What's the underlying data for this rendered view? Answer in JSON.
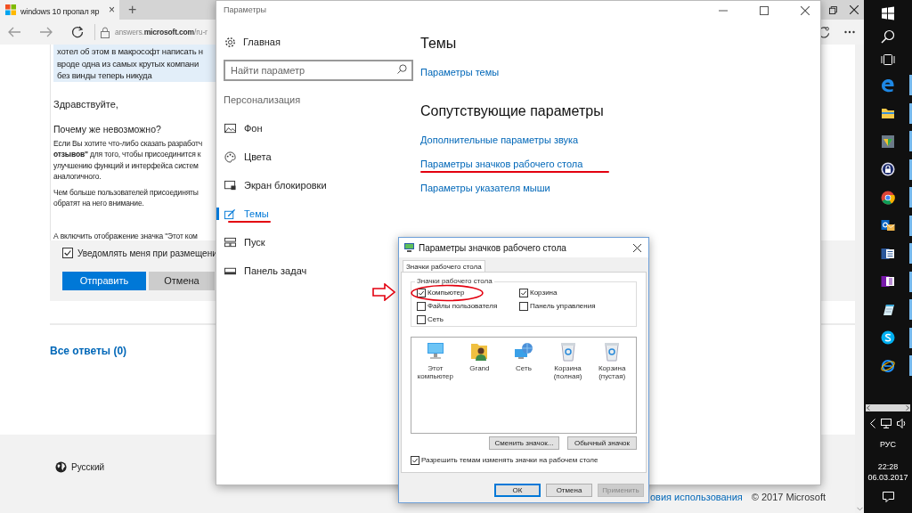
{
  "browser": {
    "tab": {
      "title": "windows 10 пропал яр",
      "close": "×",
      "selected": true
    },
    "new_tab": "+",
    "address": "answers.**microsoft.com**/ru-r",
    "quote_lines": [
      "хотел об этом в макрософт написать н",
      "вроде одна из самых крутых компани",
      "без винды теперь никуда"
    ],
    "greeting": "Здравствуйте,",
    "question": "Почему же невозможно?",
    "paragraphs": [
      [
        "Если Вы хотите что-либо сказать разработч",
        "**отзывов\"** для того, чтобы присоединится к",
        "улучшению функций и интерфейса систем",
        "аналогичного."
      ],
      [
        "Чем больше пользователей присоединяты",
        "обратят на него внимание."
      ],
      [
        "А включить отображение значка \"Этот ком"
      ]
    ],
    "notify": {
      "label": "Уведомлять меня при размещени",
      "checked": true
    },
    "buttons": [
      {
        "label": "Отправить",
        "kind": "primary"
      },
      {
        "label": "Отмена",
        "kind": "secondary"
      }
    ],
    "all_answers": "Все ответы (0)",
    "language": "Русский",
    "footer_link": "овия использования",
    "copyright": "© 2017 Microsoft"
  },
  "settings": {
    "title": "Параметры",
    "home": "Главная",
    "search": {
      "placeholder": "Найти параметр"
    },
    "section": "Персонализация",
    "nav": [
      {
        "label": "Фон",
        "kind": "background",
        "selected": false,
        "highlighted": false
      },
      {
        "label": "Цвета",
        "kind": "colors",
        "selected": false,
        "highlighted": false
      },
      {
        "label": "Экран блокировки",
        "kind": "lock",
        "selected": false,
        "highlighted": false
      },
      {
        "label": "Темы",
        "kind": "themes",
        "selected": true,
        "highlighted": true
      },
      {
        "label": "Пуск",
        "kind": "start",
        "selected": false,
        "highlighted": false
      },
      {
        "label": "Панель задач",
        "kind": "taskbar",
        "selected": false,
        "highlighted": false
      }
    ],
    "heading": "Темы",
    "theme_link": "Параметры темы",
    "related_heading": "Сопутствующие параметры",
    "related_links": [
      {
        "label": "Дополнительные параметры звука",
        "highlighted": false
      },
      {
        "label": "Параметры значков рабочего стола",
        "highlighted": true
      },
      {
        "label": "Параметры указателя мыши",
        "highlighted": false
      }
    ]
  },
  "dialog": {
    "title": "Параметры значков рабочего стола",
    "tab": "Значки рабочего стола",
    "group": "Значки рабочего стола",
    "checkboxes": [
      {
        "label": "Компьютер",
        "checked": true,
        "highlighted": true
      },
      {
        "label": "Корзина",
        "checked": true,
        "highlighted": false
      },
      {
        "label": "Файлы пользователя",
        "checked": false,
        "highlighted": false
      },
      {
        "label": "Панель управления",
        "checked": false,
        "highlighted": false
      },
      {
        "label": "Сеть",
        "checked": false,
        "highlighted": false
      }
    ],
    "icons": [
      {
        "label": "Этот компьютер",
        "kind": "computer"
      },
      {
        "label": "Grand",
        "kind": "user"
      },
      {
        "label": "Сеть",
        "kind": "network"
      },
      {
        "label": "Корзина (полная)",
        "kind": "bin"
      },
      {
        "label": "Корзина (пустая)",
        "kind": "bin"
      }
    ],
    "change_button": "Сменить значок...",
    "default_button": "Обычный значок",
    "allow_themes": {
      "label": "Разрешить темам изменять значки на рабочем столе",
      "checked": true
    },
    "buttons": [
      {
        "label": "ОК",
        "kind": "default",
        "disabled": false
      },
      {
        "label": "Отмена",
        "kind": "normal",
        "disabled": false
      },
      {
        "label": "Применить",
        "kind": "normal",
        "disabled": true
      }
    ]
  },
  "taskbar": {
    "apps": [
      {
        "kind": "edge",
        "running": true
      },
      {
        "kind": "folder",
        "running": true
      },
      {
        "kind": "maps",
        "running": true
      },
      {
        "kind": "lock",
        "running": true
      },
      {
        "kind": "chrome",
        "running": true
      },
      {
        "kind": "mail",
        "running": true
      },
      {
        "kind": "word",
        "running": true
      },
      {
        "kind": "notes",
        "running": true
      },
      {
        "kind": "notepad",
        "running": true
      },
      {
        "kind": "skype",
        "running": true
      },
      {
        "kind": "ie",
        "running": true
      }
    ],
    "language": "РУС",
    "time": "22:28",
    "date": "06.03.2017"
  }
}
